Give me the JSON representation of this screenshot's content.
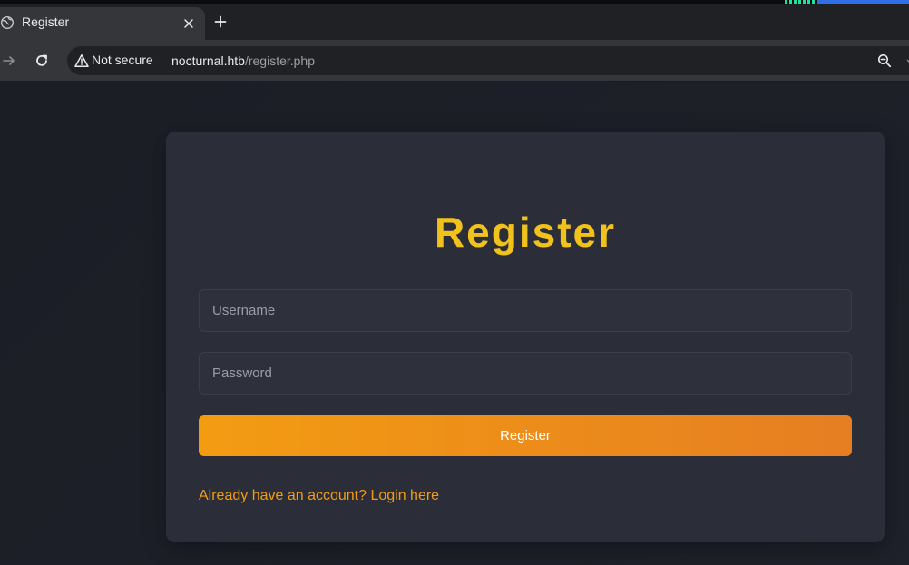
{
  "browser": {
    "tab": {
      "title": "Register"
    },
    "address_bar": {
      "security_label": "Not secure",
      "host": "nocturnal.htb",
      "path": "/register.php"
    },
    "icons": {
      "favicon": "globe-icon",
      "tab_close": "close-icon",
      "new_tab": "plus-icon",
      "forward": "arrow-right-icon",
      "reload": "reload-icon",
      "security": "warning-icon",
      "zoom": "zoom-out-icon"
    }
  },
  "register_form": {
    "title": "Register",
    "username_placeholder": "Username",
    "password_placeholder": "Password",
    "submit_label": "Register",
    "login_link": "Already have an account? Login here"
  },
  "colors": {
    "title": "#f1c21b",
    "button_gradient_start": "#f39c12",
    "button_gradient_end": "#e67e22",
    "link": "#f39c12",
    "card_bg": "#2b2d38",
    "page_bg": "#1e2029"
  }
}
